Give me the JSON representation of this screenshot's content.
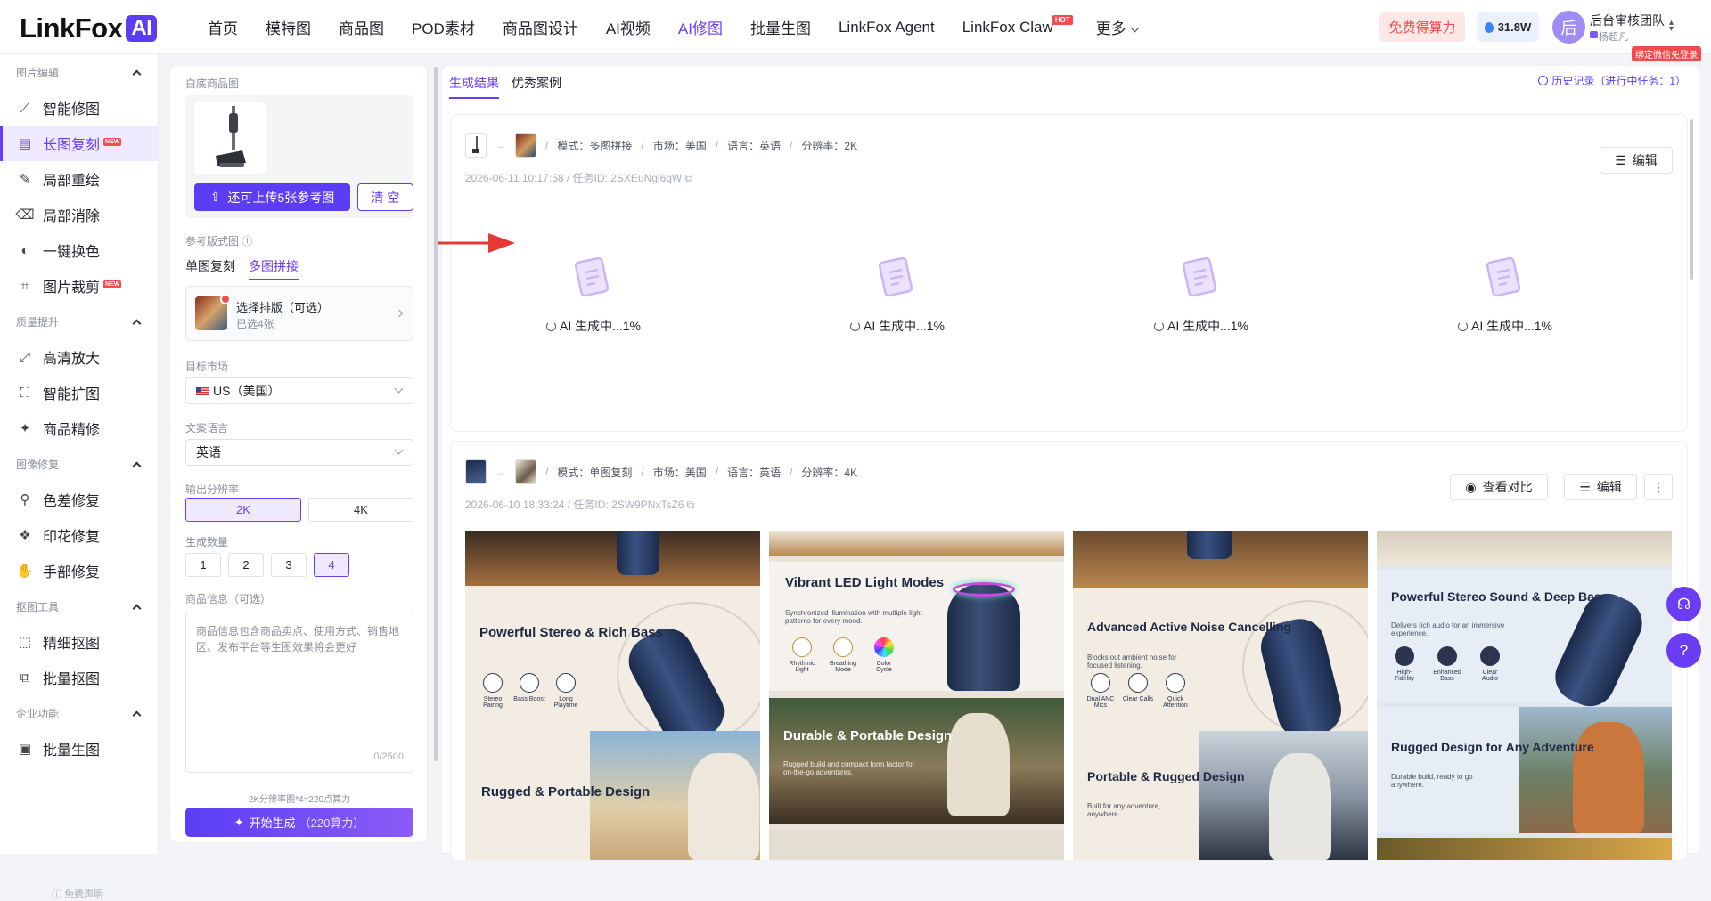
{
  "brand": {
    "name": "LinkFox",
    "ai": "AI"
  },
  "nav": [
    {
      "label": "首页"
    },
    {
      "label": "模特图"
    },
    {
      "label": "商品图"
    },
    {
      "label": "POD素材"
    },
    {
      "label": "商品图设计"
    },
    {
      "label": "AI视频"
    },
    {
      "label": "AI修图",
      "active": true
    },
    {
      "label": "批量生图"
    },
    {
      "label": "LinkFox Agent"
    },
    {
      "label": "LinkFox Claw",
      "badge": "HOT"
    },
    {
      "label": "更多"
    }
  ],
  "header": {
    "free_btn": "免费得算力",
    "points": "31.8W",
    "avatar_char": "后",
    "user_name": "后台审核团队",
    "user_sub": "杨超凡",
    "bind_tip": "绑定微信免登录"
  },
  "sidebar": {
    "sections": [
      {
        "title": "图片编辑",
        "items": [
          {
            "label": "智能修图",
            "icon": "magic-wand-icon"
          },
          {
            "label": "长图复刻",
            "icon": "document-icon",
            "badge": "NEW",
            "active": true
          },
          {
            "label": "局部重绘",
            "icon": "brush-icon"
          },
          {
            "label": "局部消除",
            "icon": "eraser-icon"
          },
          {
            "label": "一键换色",
            "icon": "palette-icon"
          },
          {
            "label": "图片裁剪",
            "icon": "crop-icon",
            "badge": "NEW"
          }
        ]
      },
      {
        "title": "质量提升",
        "items": [
          {
            "label": "高清放大",
            "icon": "expand-icon"
          },
          {
            "label": "智能扩图",
            "icon": "outpaint-icon"
          },
          {
            "label": "商品精修",
            "icon": "retouch-icon"
          }
        ]
      },
      {
        "title": "图像修复",
        "items": [
          {
            "label": "色差修复",
            "icon": "color-fix-icon"
          },
          {
            "label": "印花修复",
            "icon": "pattern-icon"
          },
          {
            "label": "手部修复",
            "icon": "hand-icon"
          }
        ]
      },
      {
        "title": "抠图工具",
        "items": [
          {
            "label": "精细抠图",
            "icon": "cutout-icon"
          },
          {
            "label": "批量抠图",
            "icon": "batch-cutout-icon"
          }
        ]
      },
      {
        "title": "企业功能",
        "items": [
          {
            "label": "批量生图",
            "icon": "image-icon"
          }
        ]
      }
    ],
    "disclaimer": "免费声明"
  },
  "panel": {
    "white_label": "白底商品图",
    "upload_btn": "还可上传5张参考图",
    "clear_btn": "清 空",
    "ref_label": "参考版式图",
    "mode_tabs": [
      {
        "label": "单图复刻"
      },
      {
        "label": "多图拼接",
        "active": true
      }
    ],
    "layout_title": "选择排版（可选）",
    "layout_sub": "已选4张",
    "market_label": "目标市场",
    "market_value": "US（美国）",
    "lang_label": "文案语言",
    "lang_value": "英语",
    "res_label": "输出分辨率",
    "res_options": [
      {
        "label": "2K",
        "active": true
      },
      {
        "label": "4K"
      }
    ],
    "qty_label": "生成数量",
    "qty_options": [
      {
        "label": "1"
      },
      {
        "label": "2"
      },
      {
        "label": "3"
      },
      {
        "label": "4",
        "active": true
      }
    ],
    "info_label": "商品信息（可选）",
    "info_placeholder": "商品信息包含商品卖点、使用方式、销售地区、发布平台等生图效果将会更好",
    "info_count": "0/2500",
    "cost_note": "2K分辨率图*4=220点算力",
    "gen_btn": "开始生成",
    "gen_cost": "（220算力）"
  },
  "main": {
    "tabs": [
      {
        "label": "生成结果",
        "active": true
      },
      {
        "label": "优秀案例"
      }
    ],
    "history": "历史记录（进行中任务：1）",
    "tasks": [
      {
        "mode": "模式：多图拼接",
        "market": "市场：美国",
        "lang": "语言：英语",
        "res": "分辨率：2K",
        "stamp": "2026-06-11 10:17:58 / 任务ID: 2SXEuNgl6qW",
        "edit": "编辑",
        "progress": [
          "AI 生成中...1%",
          "AI 生成中...1%",
          "AI 生成中...1%",
          "AI 生成中...1%"
        ]
      },
      {
        "mode": "模式：单图复刻",
        "market": "市场：美国",
        "lang": "语言：英语",
        "res": "分辨率：4K",
        "stamp": "2026-06-10 18:33:24 / 任务ID: 2SW9PNxTsZ6",
        "compare": "查看对比",
        "edit": "编辑"
      }
    ],
    "images": [
      {
        "h1": "Powerful Stereo & Rich Bass",
        "icons": [
          "Stereo Pairing",
          "Bass Boost",
          "Long Playtime"
        ],
        "h2": "Rugged & Portable Design"
      },
      {
        "h1": "Vibrant LED Light Modes",
        "sub1": "Synchronized illumination with multiple light patterns for every mood.",
        "icons": [
          "Rhythmic Light",
          "Breathing Mode",
          "Color Cycle"
        ],
        "h2": "Durable & Portable Design",
        "sub2": "Rugged build and compact form factor for on-the-go adventures."
      },
      {
        "h1": "Advanced Active Noise Cancelling",
        "sub1": "Blocks out ambient noise for focused listening.",
        "icons": [
          "Dual ANC Mics",
          "Clear Calls",
          "Quick Attention"
        ],
        "h2": "Portable & Rugged Design",
        "sub2": "Built for any adventure, anywhere."
      },
      {
        "h1": "Powerful Stereo Sound & Deep Bass",
        "sub1": "Delivers rich audio for an immersive experience.",
        "icons": [
          "High-Fidelity",
          "Enhanced Bass",
          "Clear Audio"
        ],
        "h2": "Rugged Design for Any Adventure",
        "sub2": "Durable build, ready to go anywhere."
      }
    ]
  },
  "colors": {
    "accent": "#6a3df3",
    "brand": "#5b3df5",
    "danger": "#f34d4d"
  }
}
